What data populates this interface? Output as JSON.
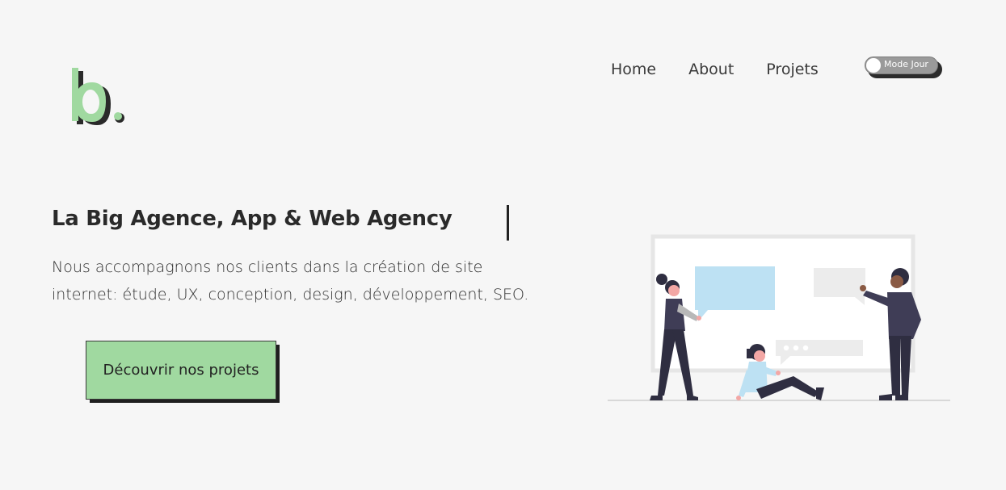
{
  "logo": {
    "text": "b.",
    "colors": {
      "letter": "#a0d9a0",
      "shadow": "#2a2a2a",
      "dot": "#a0d9a0"
    }
  },
  "nav": {
    "items": [
      {
        "label": "Home"
      },
      {
        "label": "About"
      },
      {
        "label": "Projets"
      }
    ]
  },
  "theme_toggle": {
    "label": "Mode Jour",
    "state": "off"
  },
  "hero": {
    "headline": "La Big Agence, App & Web Agency",
    "description": "Nous accompagnons nos clients dans la création de site internet: étude, UX, conception, design, développement, SEO.",
    "cta_label": "Découvrir nos projets"
  },
  "colors": {
    "background": "#f6f6f6",
    "accent": "#a0d9a0",
    "text": "#2a2a2a",
    "illustration_blue": "#bde1f3"
  },
  "illustration": {
    "icon": "team-presentation-illustration"
  }
}
